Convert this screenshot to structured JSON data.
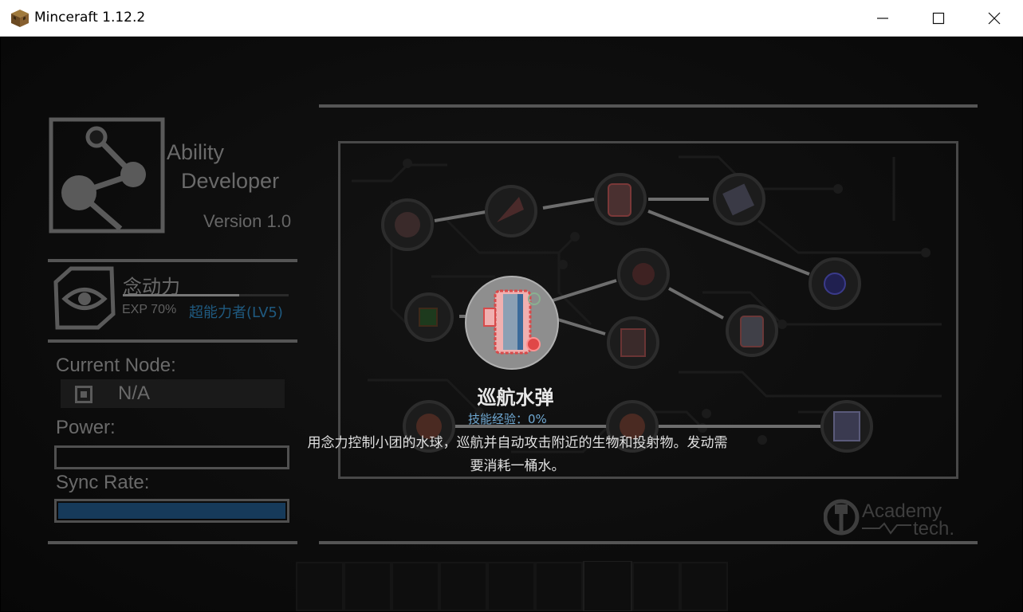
{
  "window": {
    "title": "Minceraft 1.12.2",
    "icon": "minecraft-block-icon",
    "controls": [
      "minimize-icon",
      "maximize-icon",
      "close-icon"
    ]
  },
  "logo": {
    "line1": "Ability",
    "line2": "Developer",
    "version": "Version 1.0"
  },
  "category": {
    "name": "念动力",
    "exp_label": "EXP 70%",
    "exp_fraction": 0.7,
    "level": "超能力者(LV5)"
  },
  "status": {
    "current_node_label": "Current Node:",
    "current_node_value": "N/A",
    "power_label": "Power:",
    "power_fraction": 0,
    "sync_label": "Sync Rate:",
    "sync_fraction": 1.0
  },
  "skill": {
    "name": "巡航水弹",
    "exp": "技能经验：0%",
    "desc_line1": "用念力控制小团的水球，巡航并自动攻击附近的生物和投射物。发动需",
    "desc_line2": "要消耗一桶水。"
  },
  "footer_logo": {
    "line1": "Academy",
    "line2": "tech."
  },
  "colors": {
    "accent_blue": "#1f5a80",
    "sync_fill": "#163a5a",
    "skill_exp": "#6fa8d2"
  }
}
